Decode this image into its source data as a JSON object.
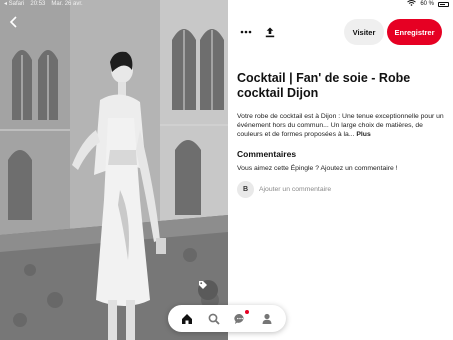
{
  "status_bar": {
    "back_app": "◂ Safari",
    "time": "20:53",
    "date": "Mar. 26 avr.",
    "battery": "60 %"
  },
  "pin": {
    "title": "Cocktail | Fan' de soie - Robe cocktail Dijon",
    "description": "Votre robe de cocktail est à Dijon : Une tenue exceptionnelle pour un événement hors du commun... Un large choix de matières, de couleurs et de formes proposées à la...",
    "more_label": "Plus"
  },
  "actions": {
    "visit_label": "Visiter",
    "save_label": "Enregistrer",
    "more_icon": "ellipsis-icon",
    "share_icon": "share-icon"
  },
  "comments": {
    "heading": "Commentaires",
    "prompt": "Vous aimez cette Épingle ? Ajoutez un commentaire !",
    "avatar_initial": "B",
    "input_placeholder": "Ajouter un commentaire"
  },
  "nav": {
    "items": [
      "home-icon",
      "search-icon",
      "messages-icon",
      "profile-icon"
    ]
  },
  "colors": {
    "accent": "#e60023",
    "visit_bg": "#efefef"
  }
}
